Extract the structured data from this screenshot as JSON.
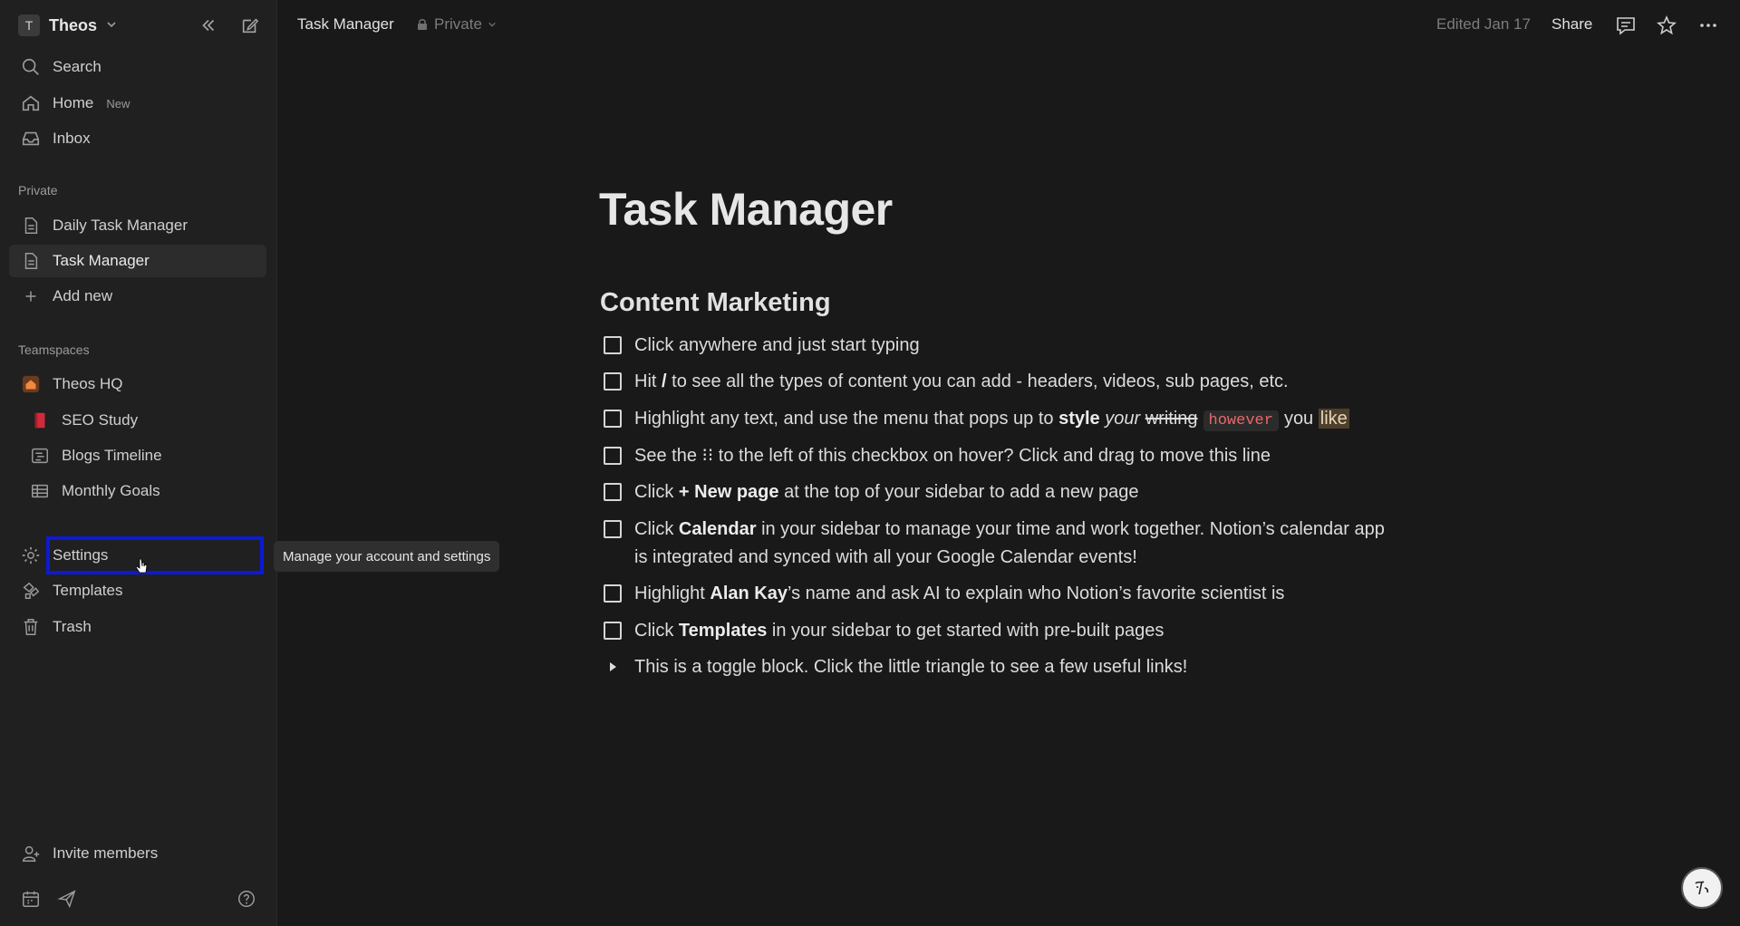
{
  "workspace": {
    "avatar_letter": "T",
    "name": "Theos"
  },
  "sidebar": {
    "search": "Search",
    "home": "Home",
    "home_badge": "New",
    "inbox": "Inbox",
    "private_label": "Private",
    "private_pages": [
      "Daily Task Manager",
      "Task Manager"
    ],
    "add_new": "Add new",
    "teamspaces_label": "Teamspaces",
    "teamspace_name": "Theos HQ",
    "teamspace_pages": [
      "SEO Study",
      "Blogs Timeline",
      "Monthly Goals"
    ],
    "settings": "Settings",
    "templates": "Templates",
    "trash": "Trash",
    "invite": "Invite members",
    "tooltip": "Manage your account and settings"
  },
  "topbar": {
    "title": "Task Manager",
    "privacy": "Private",
    "edited": "Edited Jan 17",
    "share": "Share"
  },
  "page": {
    "title": "Task Manager",
    "heading": "Content Marketing",
    "todo1": "Click anywhere and just start typing",
    "todo2_a": "Hit",
    "todo2_b": "/",
    "todo2_c": "to see all the types of content you can add - headers, videos, sub pages, etc.",
    "todo3_a": "Highlight any text, and use the menu that pops up to",
    "todo3_b": "style",
    "todo3_c": "your",
    "todo3_d": "writing",
    "todo3_e": "however",
    "todo3_f": "you",
    "todo3_g": "like",
    "todo4": "See the ⁝⁝ to the left of this checkbox on hover? Click and drag to move this line",
    "todo5_a": "Click",
    "todo5_b": "+ New page",
    "todo5_c": "at the top of your sidebar to add a new page",
    "todo6_a": "Click",
    "todo6_b": "Calendar",
    "todo6_c": "in your sidebar to manage your time and work together. Notion’s calendar app is integrated and synced with all your Google Calendar events!",
    "todo7_a": "Highlight",
    "todo7_b": "Alan Kay",
    "todo7_c": "’s name and ask AI to explain who Notion’s favorite scientist is",
    "todo8_a": "Click",
    "todo8_b": "Templates",
    "todo8_c": "in your sidebar to get started with pre-built pages",
    "toggle": "This is a toggle block. Click the little triangle to see a few useful links!"
  },
  "colors": {
    "accent_highlight_box": "#0d1ad4",
    "code_text": "#e7686a",
    "background": "#191919"
  }
}
